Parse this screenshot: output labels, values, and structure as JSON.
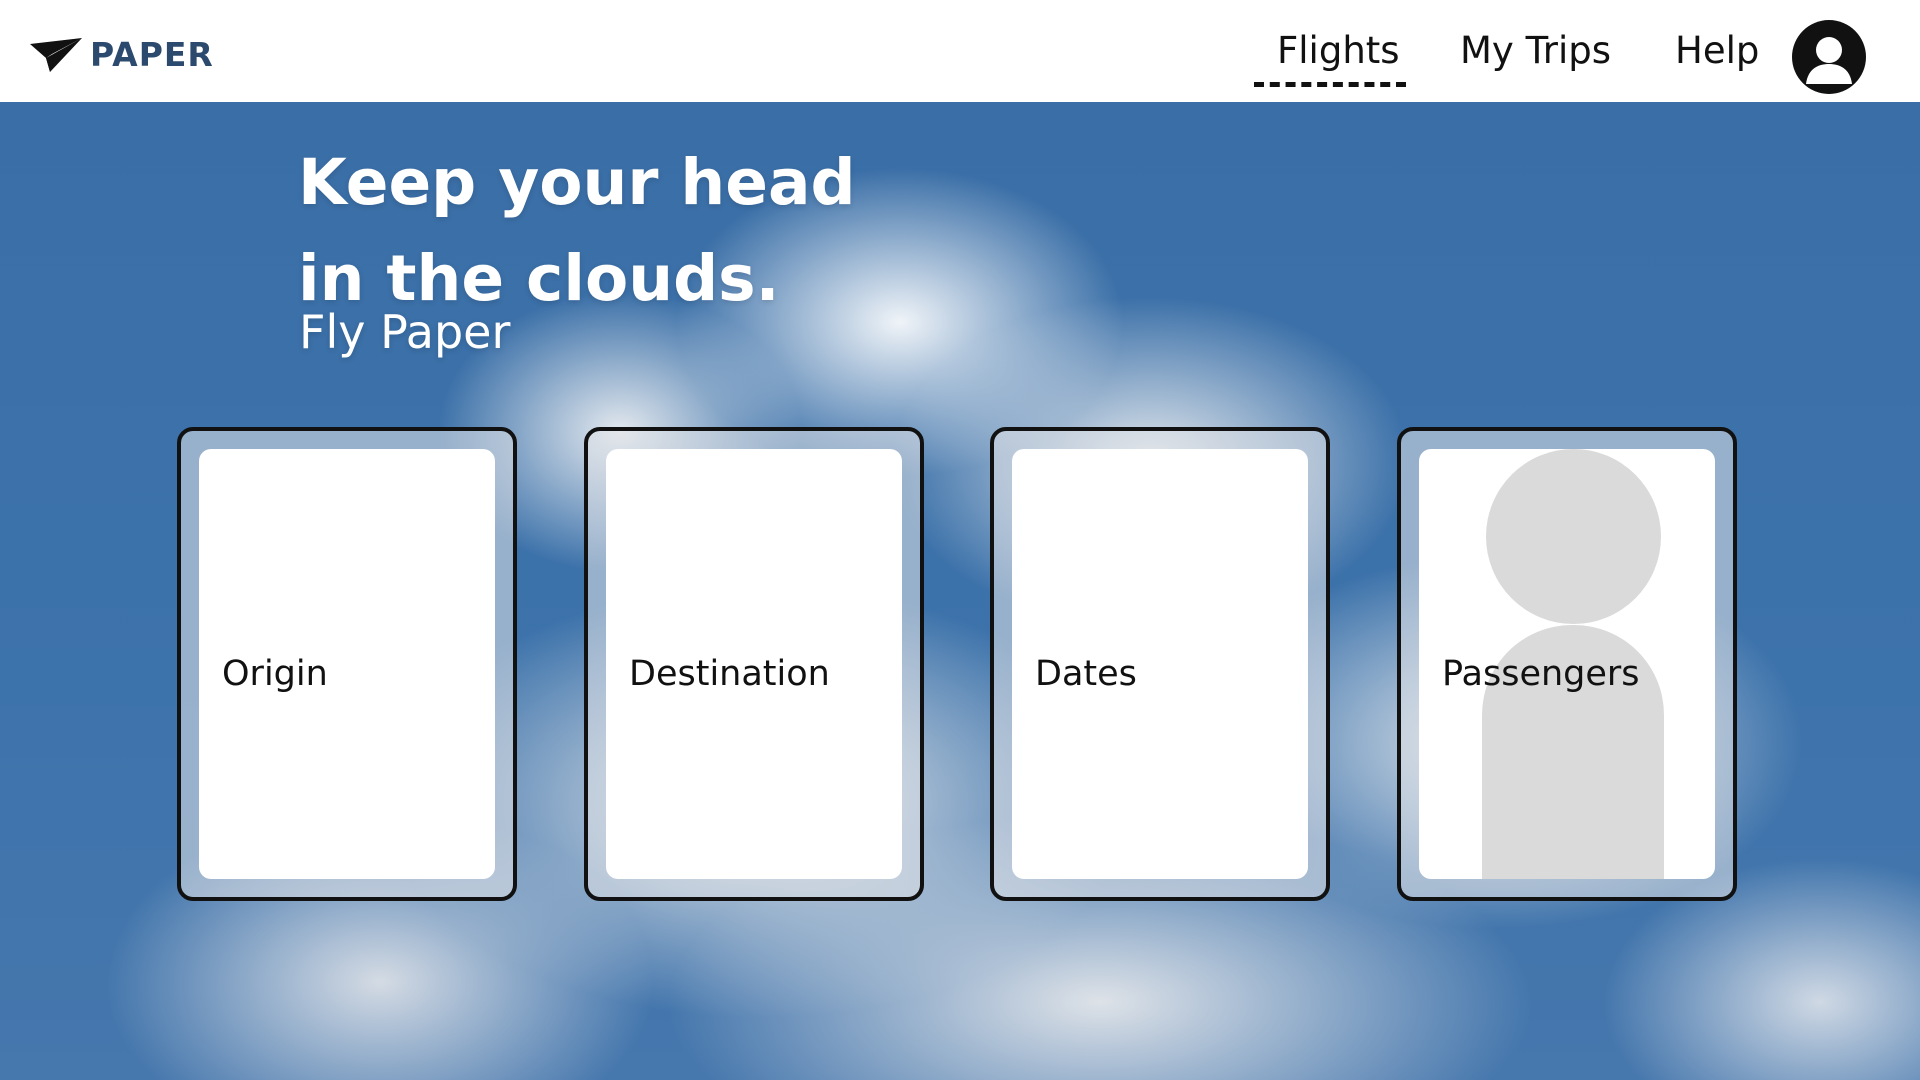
{
  "header": {
    "brand": "PAPER",
    "logo_icon": "paper-plane-icon",
    "nav": {
      "flights": "Flights",
      "my_trips": "My Trips",
      "help": "Help",
      "active": "flights"
    },
    "profile_icon": "user-avatar-icon"
  },
  "hero": {
    "headline_line1": "Keep your head",
    "headline_line2": "in the clouds.",
    "subhead": "Fly Paper"
  },
  "cards": {
    "origin": "Origin",
    "destination": "Destination",
    "dates": "Dates",
    "passengers": "Passengers"
  },
  "colors": {
    "brand_text": "#2c4a6e",
    "sky": "#3b70a8",
    "card_border": "#111111",
    "placeholder_gray": "#dadada"
  }
}
